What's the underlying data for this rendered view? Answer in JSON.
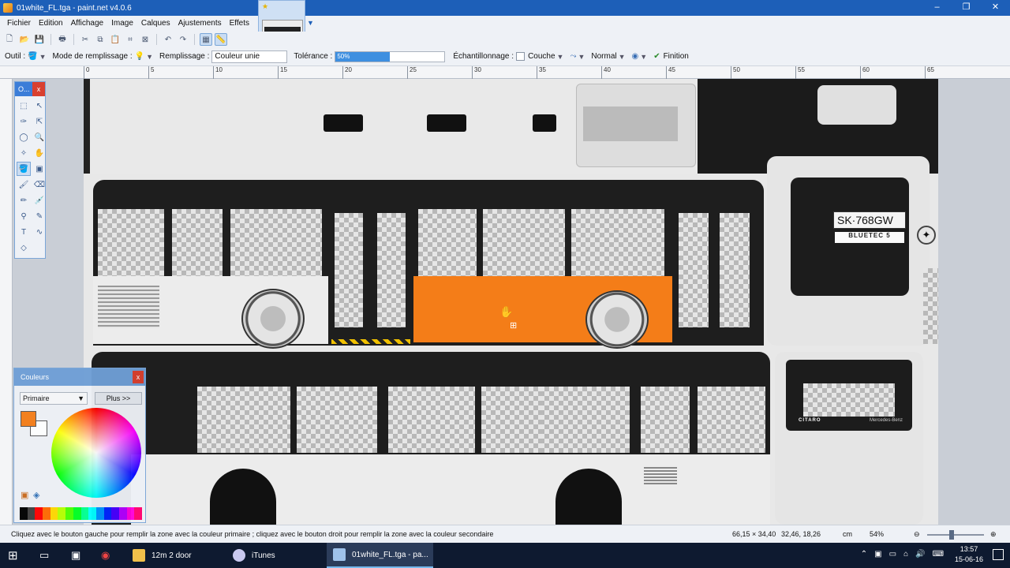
{
  "window": {
    "title": "01white_FL.tga - paint.net v4.0.6",
    "buttons": [
      "–",
      "❐",
      "✕"
    ]
  },
  "menu": {
    "items": [
      "Fichier",
      "Edition",
      "Affichage",
      "Image",
      "Calques",
      "Ajustements",
      "Effets"
    ]
  },
  "image_tab": {
    "modified_marker": "★"
  },
  "options": {
    "tool_label": "Outil :",
    "fill_mode_label": "Mode de remplissage :",
    "fill_label": "Remplissage :",
    "fill_value": "Couleur unie",
    "tolerance_label": "Tolérance :",
    "tolerance_value": "50%",
    "tolerance_fraction": 0.5,
    "sampling_label": "Échantillonnage :",
    "sampling_value": "Couche",
    "blend_value": "Normal",
    "finish_label": "Finition"
  },
  "ruler": {
    "ticks": [
      "0",
      "5",
      "10",
      "15",
      "20",
      "25",
      "30",
      "35",
      "40",
      "45",
      "50",
      "55",
      "60",
      "65"
    ]
  },
  "tools_panel": {
    "title": "O...",
    "close": "x"
  },
  "colors_panel": {
    "title": "Couleurs",
    "close": "x",
    "mode": "Primaire",
    "more_button": "Plus >>",
    "primary_color": "#f47d18",
    "secondary_color": "#ffffff",
    "palette": [
      "#000000",
      "#404040",
      "#ff0000",
      "#ff6a00",
      "#ffd800",
      "#b6ff00",
      "#4cff00",
      "#00ff21",
      "#00ff90",
      "#00ffff",
      "#0094ff",
      "#0026ff",
      "#4800ff",
      "#b200ff",
      "#ff00dc",
      "#ff006e"
    ]
  },
  "image_content": {
    "license_plate": "SK·768GW",
    "badge": "BLUETEC 5",
    "model": "CITARO",
    "maker": "Mercedes-Benz",
    "fill_color": "#f47d18"
  },
  "status": {
    "message": "Cliquez avec le bouton gauche pour remplir la zone avec la couleur primaire ; cliquez avec le bouton droit pour remplir la zone avec la couleur secondaire",
    "image_size": "66,15 × 34,40",
    "cursor_pos": "32,46, 18,26",
    "unit": "cm",
    "zoom": "54%"
  },
  "taskbar": {
    "items": [
      {
        "label": "12m 2 door"
      },
      {
        "label": "iTunes"
      },
      {
        "label": "01white_FL.tga - pa..."
      }
    ],
    "time": "13:57",
    "date": "15-06-16"
  }
}
